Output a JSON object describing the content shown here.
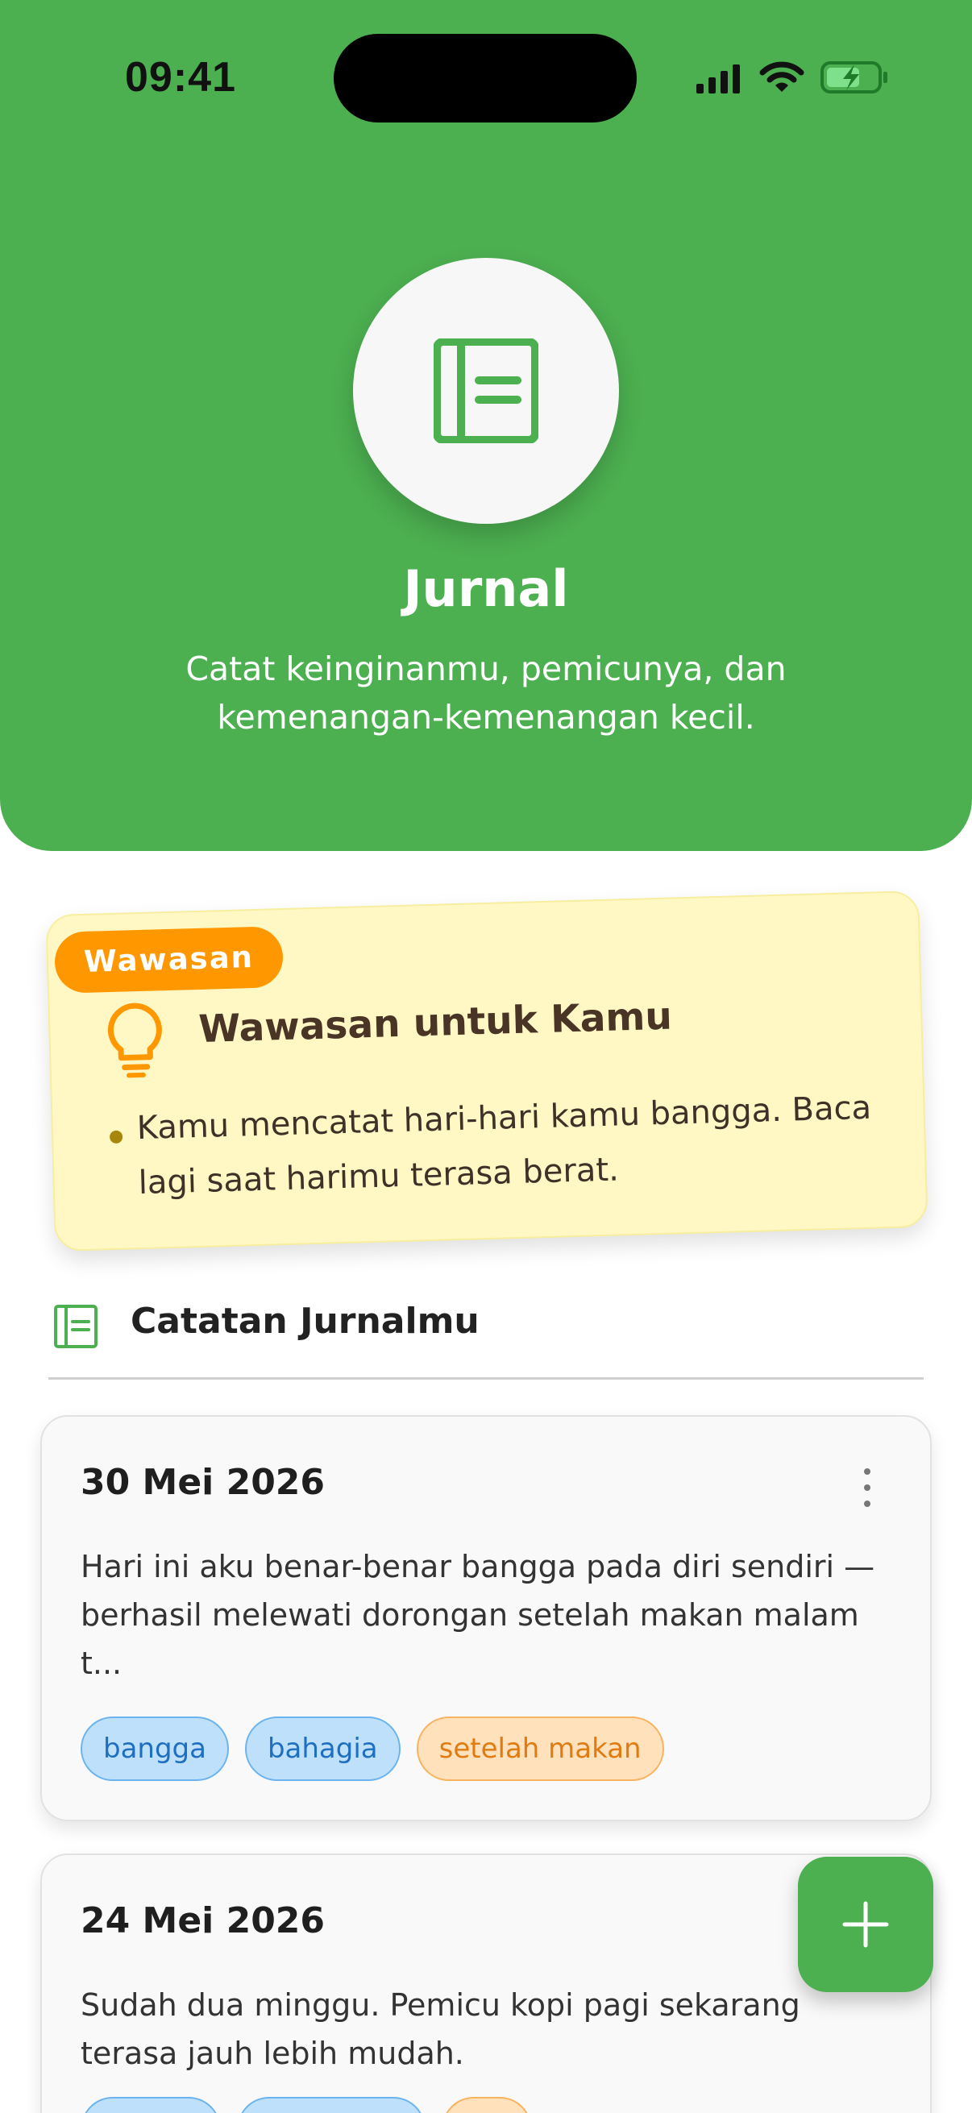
{
  "status_bar": {
    "time": "09:41"
  },
  "header": {
    "title": "Jurnal",
    "subtitle": "Catat keinginanmu, pemicunya, dan kemenangan-kemenangan kecil."
  },
  "insight": {
    "badge": "Wawasan",
    "title": "Wawasan untuk Kamu",
    "points": [
      "Kamu mencatat hari-hari kamu bangga. Baca lagi saat harimu terasa berat."
    ]
  },
  "journal_section": {
    "title": "Catatan Jurnalmu"
  },
  "entries": [
    {
      "date": "30 Mei 2026",
      "text": "Hari ini aku benar-benar bangga pada diri sendiri — berhasil melewati dorongan setelah makan malam t...",
      "tags": [
        {
          "label": "bangga",
          "kind": "mood"
        },
        {
          "label": "bahagia",
          "kind": "mood"
        },
        {
          "label": "setelah makan",
          "kind": "trigger"
        }
      ]
    },
    {
      "date": "24 Mei 2026",
      "text": "Sudah dua minggu. Pemicu kopi pagi sekarang terasa jauh lebih mudah."
    }
  ],
  "colors": {
    "primary": "#4caf50",
    "insight_bg": "#fff8c4",
    "badge": "#ff9800",
    "mood_tag": "#bfe0fb",
    "trigger_tag": "#ffe1bc"
  },
  "icons": {
    "app": "journal-icon",
    "insight": "lightbulb-icon",
    "section": "journal-icon",
    "fab": "plus-icon",
    "entry_menu": "more-vertical-icon"
  }
}
